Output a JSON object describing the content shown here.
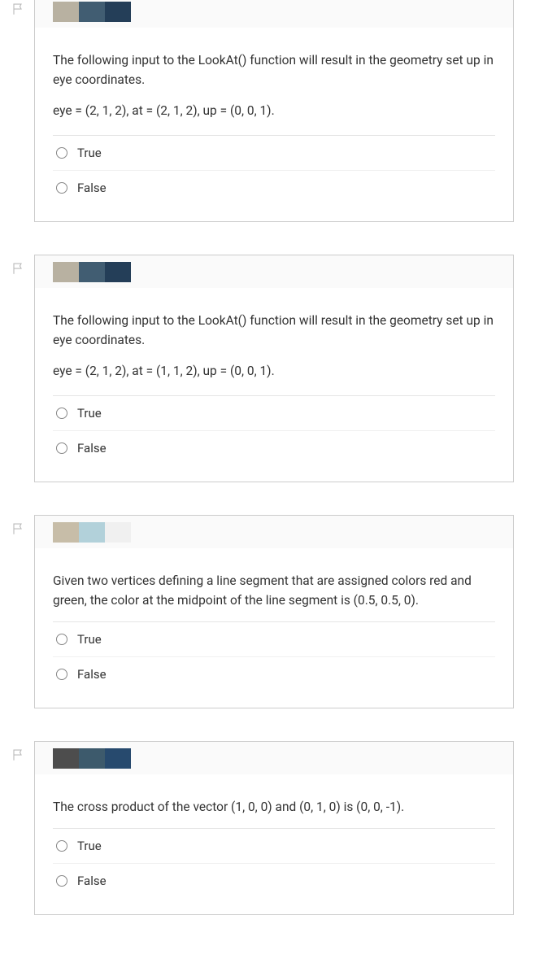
{
  "questions": [
    {
      "prompt": "The following input to the LookAt() function will result in the geometry set up in eye coordinates.",
      "detail": "eye = (2, 1, 2),  at = (2, 1, 2), up = (0, 0, 1).",
      "options": {
        "true": "True",
        "false": "False"
      }
    },
    {
      "prompt": "The following input to the LookAt() function will result in the geometry set up in eye coordinates.",
      "detail": "eye = (2, 1, 2),  at = (1, 1, 2), up = (0, 0, 1).",
      "options": {
        "true": "True",
        "false": "False"
      }
    },
    {
      "prompt": "Given two vertices defining a line segment that are assigned colors red and green, the color at the midpoint of the line segment is (0.5, 0.5, 0).",
      "detail": "",
      "options": {
        "true": "True",
        "false": "False"
      }
    },
    {
      "prompt": "The cross product of the vector (1, 0, 0) and (0, 1, 0) is (0, 0, -1).",
      "detail": "",
      "options": {
        "true": "True",
        "false": "False"
      }
    }
  ]
}
